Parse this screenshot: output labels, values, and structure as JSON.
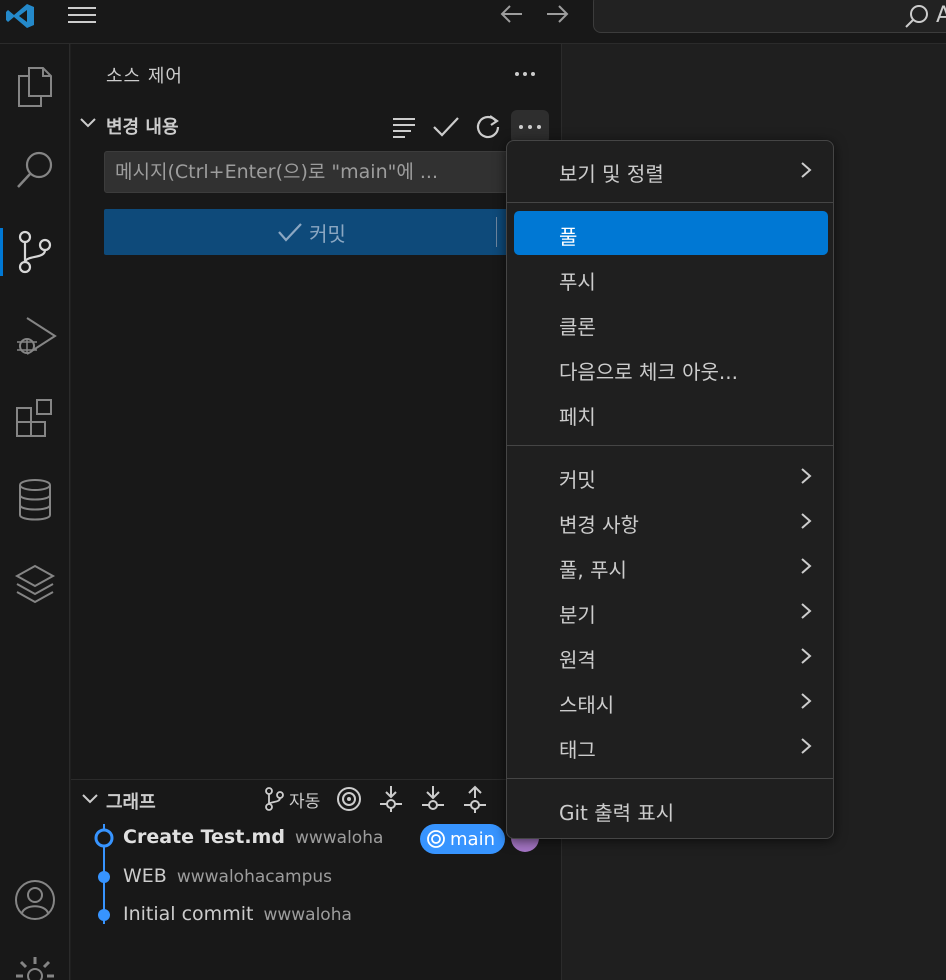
{
  "titlebar": {
    "command_center_text": "A"
  },
  "sidebar": {
    "title": "소스 제어",
    "changes_section": {
      "title": "변경 내용",
      "message_placeholder": "메시지(Ctrl+Enter(으)로 \"main\"에 ...",
      "commit_label": "커밋"
    },
    "graph_section": {
      "title": "그래프",
      "auto_label": "자동",
      "commits": [
        {
          "message": "Create Test.md",
          "author": "wwwaloha",
          "branch": "main"
        },
        {
          "message": "WEB",
          "author": "wwwalohacampus"
        },
        {
          "message": "Initial commit",
          "author": "wwwaloha"
        }
      ]
    }
  },
  "context_menu": {
    "group1": [
      {
        "label": "보기 및 정렬",
        "submenu": true
      }
    ],
    "group2": [
      {
        "label": "풀",
        "submenu": false,
        "selected": true
      },
      {
        "label": "푸시",
        "submenu": false
      },
      {
        "label": "클론",
        "submenu": false
      },
      {
        "label": "다음으로 체크 아웃...",
        "submenu": false
      },
      {
        "label": "페치",
        "submenu": false
      }
    ],
    "group3": [
      {
        "label": "커밋",
        "submenu": true
      },
      {
        "label": "변경 사항",
        "submenu": true
      },
      {
        "label": "풀, 푸시",
        "submenu": true
      },
      {
        "label": "분기",
        "submenu": true
      },
      {
        "label": "원격",
        "submenu": true
      },
      {
        "label": "스태시",
        "submenu": true
      },
      {
        "label": "태그",
        "submenu": true
      }
    ],
    "group4": [
      {
        "label": "Git 출력 표시",
        "submenu": false
      }
    ]
  },
  "colors": {
    "accent": "#0078d4",
    "badge": "#3794ff",
    "commit_button": "#0e4a7a"
  }
}
